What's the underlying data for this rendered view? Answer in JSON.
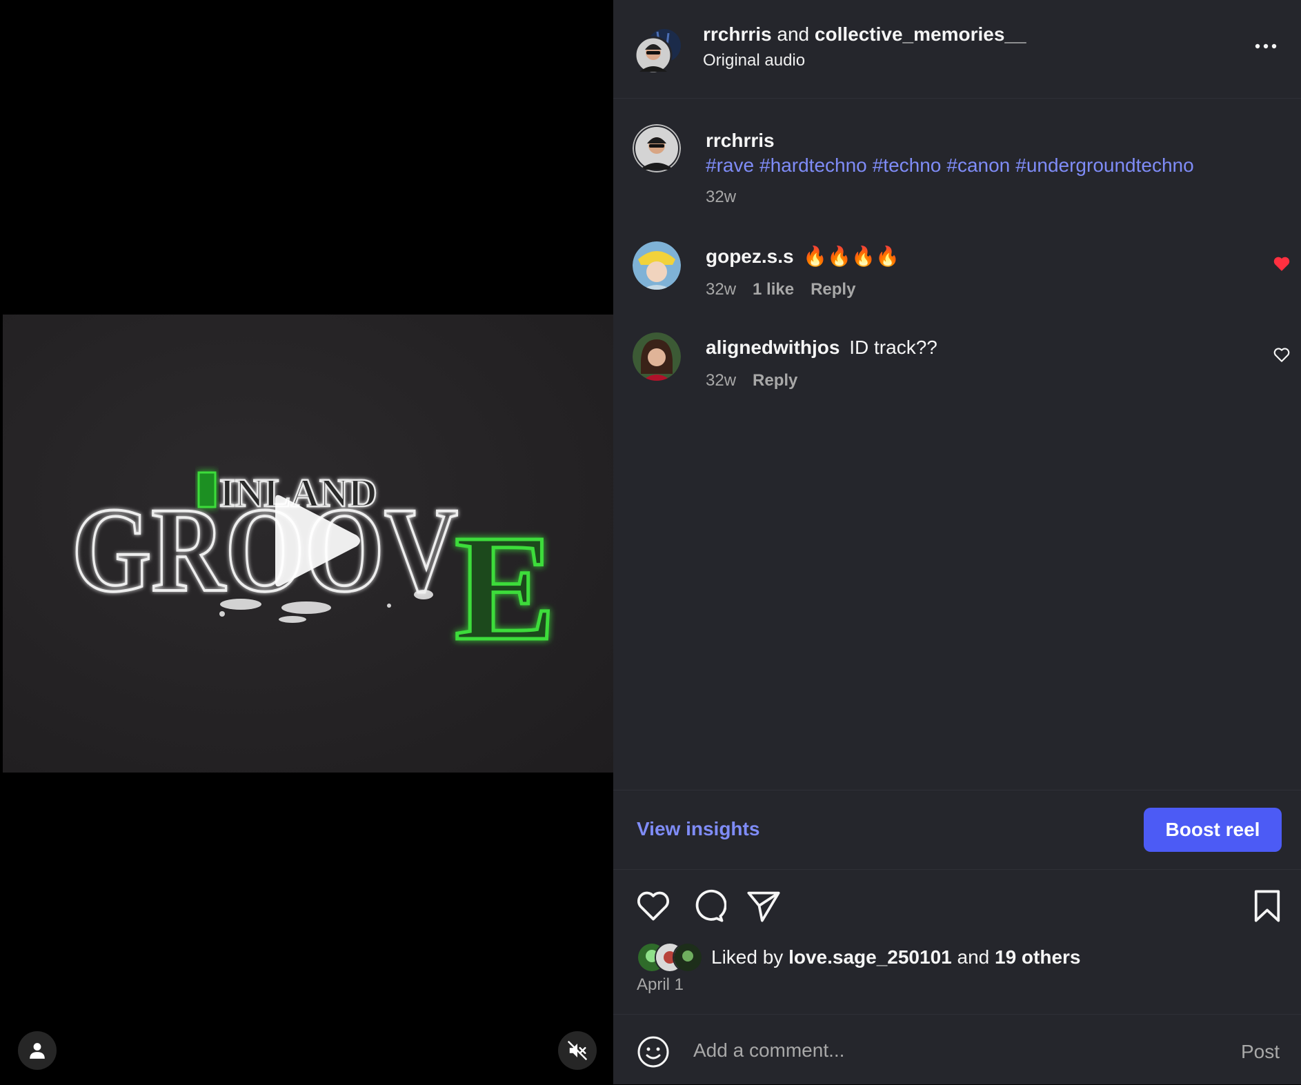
{
  "header": {
    "user1": "rrchrris",
    "conjunction": " and ",
    "user2": "collective_memories__",
    "audio": "Original audio",
    "more_icon": "more-horizontal-icon"
  },
  "caption": {
    "username": "rrchrris",
    "hashtags": [
      "#rave",
      "#hardtechno",
      "#techno",
      "#canon",
      "#undergroundtechno"
    ],
    "time": "32w"
  },
  "comments": [
    {
      "username": "gopez.s.s",
      "text": "🔥🔥🔥🔥",
      "time": "32w",
      "likes": "1 like",
      "reply": "Reply",
      "liked": true
    },
    {
      "username": "alignedwithjos",
      "text": "ID track??",
      "time": "32w",
      "reply": "Reply",
      "liked": false
    }
  ],
  "insights": {
    "view_label": "View insights",
    "boost_label": "Boost reel"
  },
  "likes": {
    "prefix": "Liked by ",
    "user": "love.sage_250101",
    "middle": " and ",
    "others": "19 others",
    "date": "April 1"
  },
  "comment_box": {
    "placeholder": "Add a comment...",
    "post_label": "Post"
  },
  "video": {
    "logo_top": "INLAND",
    "logo_main": "GROOVE"
  },
  "colors": {
    "accent": "#4c5bf5",
    "link": "#7f8cf7",
    "liked_heart": "#ff3040",
    "panel_bg": "#25262c",
    "neon_green": "#3ddc3a"
  }
}
